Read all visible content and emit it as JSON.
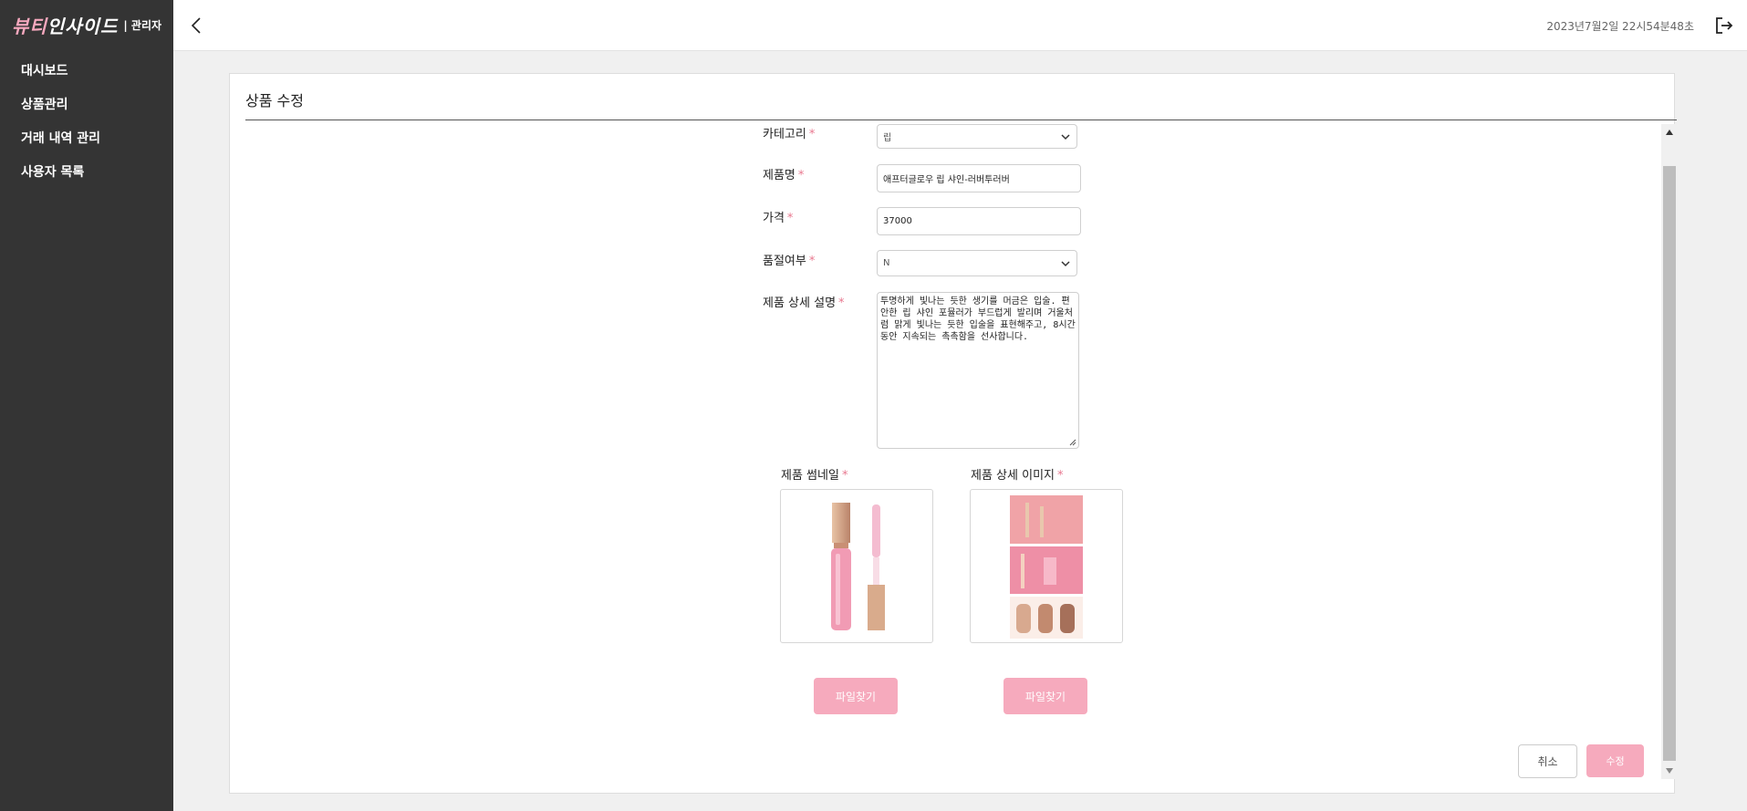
{
  "sidebar": {
    "logo_main_1": "뷰티",
    "logo_main_2": "인사이드",
    "logo_sub": "| 관리자",
    "items": [
      {
        "label": "대시보드"
      },
      {
        "label": "상품관리"
      },
      {
        "label": "거래 내역 관리"
      },
      {
        "label": "사용자 목록"
      }
    ]
  },
  "header": {
    "datetime": "2023년7월2일 22시54분48초",
    "back_icon": "chevron-left-icon",
    "logout_icon": "logout-icon"
  },
  "card": {
    "title": "상품 수정"
  },
  "form": {
    "required_mark": "*",
    "category": {
      "label": "카테고리",
      "value": "립"
    },
    "name": {
      "label": "제품명",
      "value": "애프터글로우 립 샤인-러버투러버"
    },
    "price": {
      "label": "가격",
      "value": "37000"
    },
    "soldout": {
      "label": "품절여부",
      "value": "N"
    },
    "description": {
      "label": "제품 상세 설명",
      "value": "투명하게 빛나는 듯한 생기를 머금은 입술. 편안한 립 샤인 포뮬러가 부드럽게 발리며 거울처럼 맑게 빛나는 듯한 입술을 표현해주고, 8시간 동안 지속되는 촉촉함을 선사합니다."
    },
    "thumbnail": {
      "label": "제품 썸네일",
      "button": "파일찾기"
    },
    "detail_image": {
      "label": "제품 상세 이미지",
      "button": "파일찾기"
    }
  },
  "actions": {
    "cancel": "취소",
    "submit": "수정"
  },
  "colors": {
    "sidebar_bg": "#343434",
    "accent_pink": "#f6aabd",
    "required": "#e8788f"
  }
}
